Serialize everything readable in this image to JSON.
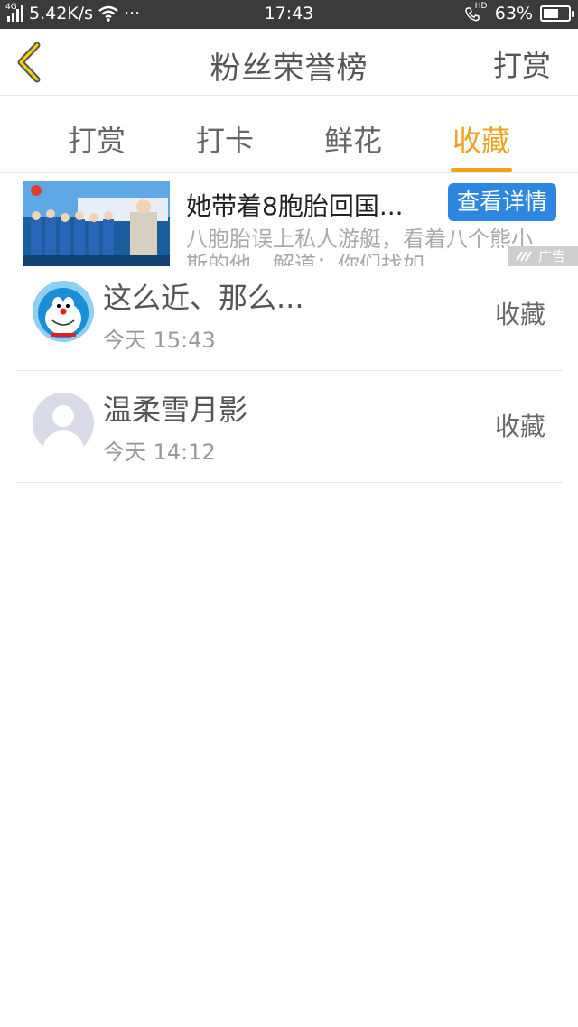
{
  "status_bar": {
    "network_type": "4G",
    "speed": "5.42K/s",
    "dots": "···",
    "time": "17:43",
    "call_badge": "HD",
    "battery": "63%",
    "battery_level": 0.63
  },
  "header": {
    "title": "粉丝荣誉榜",
    "action": "打赏"
  },
  "tabs": [
    {
      "label": "打赏",
      "active": false
    },
    {
      "label": "打卡",
      "active": false
    },
    {
      "label": "鲜花",
      "active": false
    },
    {
      "label": "收藏",
      "active": true
    }
  ],
  "ad": {
    "title": "她带着8胞胎回国...",
    "button": "查看详情",
    "description": "八胞胎误上私人游艇，看着八个熊小斯的他，解道：你们找如",
    "badge": "广告"
  },
  "list": [
    {
      "name": "这么近、那么...",
      "time": "今天 15:43",
      "action": "收藏",
      "avatar": "cartoon-cat"
    },
    {
      "name": "温柔雪月影",
      "time": "今天 14:12",
      "action": "收藏",
      "avatar": "default-user"
    }
  ],
  "colors": {
    "accent": "#f0a21c",
    "ad_button": "#2d86e0",
    "status_bar": "#3b3b3b"
  }
}
